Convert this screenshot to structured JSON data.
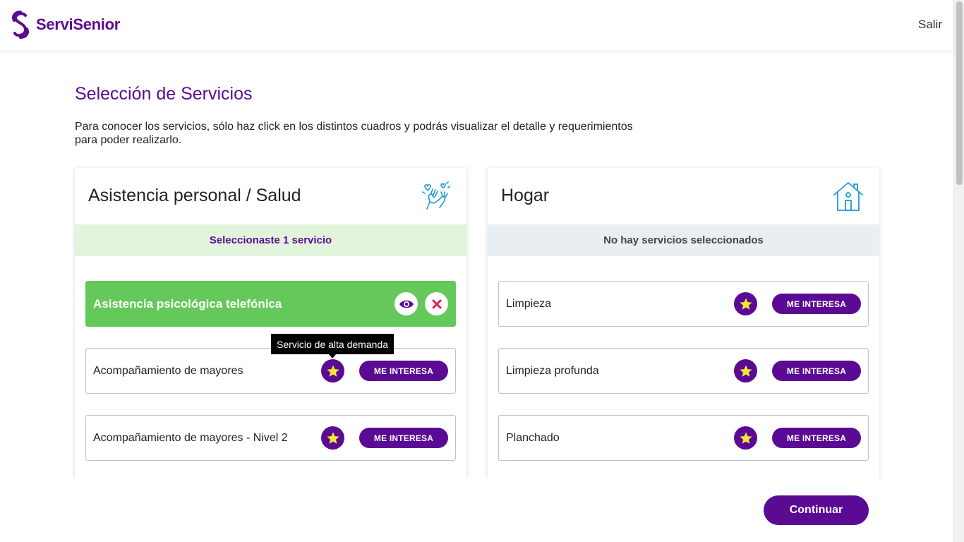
{
  "header": {
    "brand": "ServiSenior",
    "logout_label": "Salir"
  },
  "page": {
    "title": "Selección de Servicios",
    "description": "Para conocer los servicios, sólo haz click en los distintos cuadros y podrás visualizar el detalle y requerimientos para poder realizarlo."
  },
  "categories": [
    {
      "title": "Asistencia personal / Salud",
      "icon": "hands-hearts-icon",
      "status": "Seleccionaste 1 servicio",
      "services": [
        {
          "name": "Asistencia psicológica telefónica",
          "selected": true
        },
        {
          "name": "Acompañamiento de mayores",
          "selected": false,
          "button": "ME INTERESA"
        },
        {
          "name": "Acompañamiento de mayores - Nivel 2",
          "selected": false,
          "button": "ME INTERESA"
        }
      ]
    },
    {
      "title": "Hogar",
      "icon": "house-icon",
      "status": "No hay servicios seleccionados",
      "services": [
        {
          "name": "Limpieza",
          "selected": false,
          "button": "ME INTERESA"
        },
        {
          "name": "Limpieza profunda",
          "selected": false,
          "button": "ME INTERESA"
        },
        {
          "name": "Planchado",
          "selected": false,
          "button": "ME INTERESA"
        }
      ]
    }
  ],
  "tooltip": "Servicio de alta demanda",
  "footer": {
    "continue_label": "Continuar"
  },
  "colors": {
    "brand": "#5b0a94",
    "selected_green": "#65c85a",
    "star_yellow": "#f2e833",
    "icon_blue": "#1a9ad6",
    "remove_red": "#e8194a"
  }
}
